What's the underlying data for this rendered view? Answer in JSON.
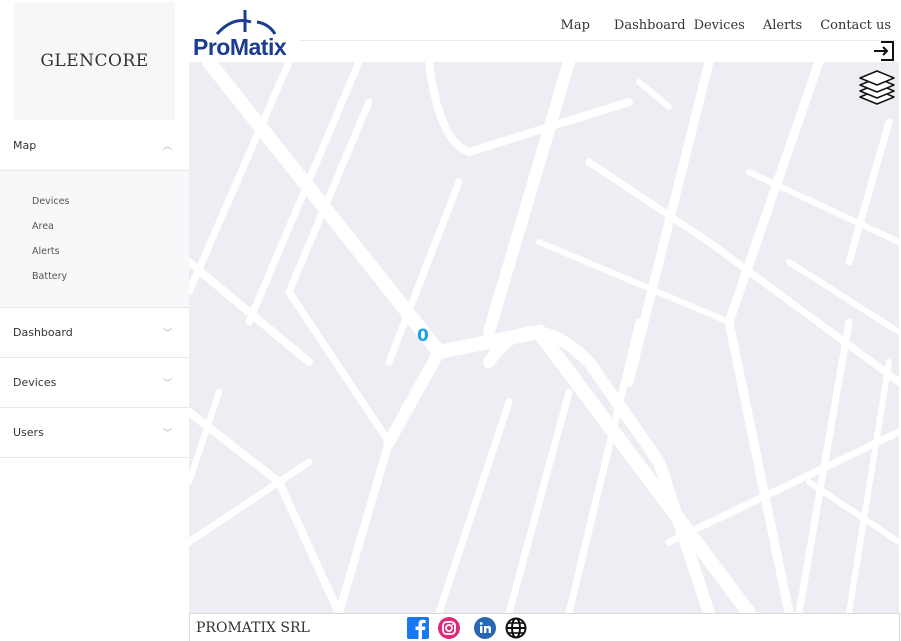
{
  "sidebar": {
    "logo_text": "GLENCORE",
    "items": [
      {
        "label": "Map",
        "expanded": true
      },
      {
        "label": "Dashboard",
        "expanded": false
      },
      {
        "label": "Devices",
        "expanded": false
      },
      {
        "label": "Users",
        "expanded": false
      }
    ],
    "map_submenu": [
      "Devices",
      "Area",
      "Alerts",
      "Battery"
    ]
  },
  "header": {
    "brand": "ProMatix",
    "nav": [
      "Map",
      "Dashboard",
      "Devices",
      "Alerts",
      "Contact us"
    ]
  },
  "map": {
    "cluster_count": "0",
    "controls": [
      "logout-icon",
      "layers-icon"
    ]
  },
  "footer": {
    "company": "PROMATIX SRL",
    "social": [
      "facebook-icon",
      "instagram-icon",
      "linkedin-icon",
      "globe-icon"
    ]
  },
  "colors": {
    "brand": "#1a3d8f",
    "accent": "#1aa3e8",
    "map_background": "#eceef3",
    "facebook": "#1877f2",
    "linkedin": "#2867b2"
  }
}
